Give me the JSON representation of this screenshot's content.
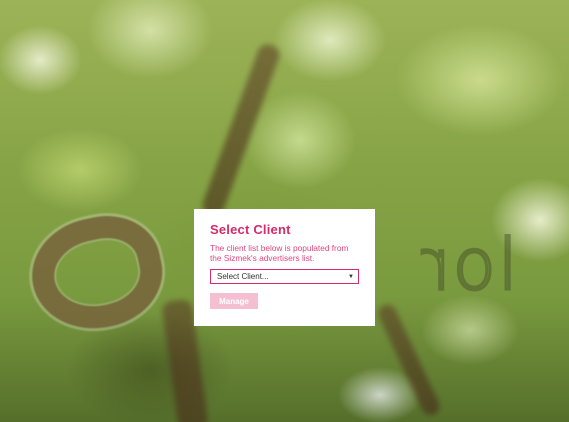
{
  "background": {
    "logo_text": "lor",
    "colors": {
      "foliage": "#86a445",
      "highlight": "#f0f8d7"
    }
  },
  "panel": {
    "title": "Select Client",
    "description": "The client list below is populated from the Sizmek's advertisers list.",
    "select": {
      "selected": "Select Client...",
      "caret_icon": "caret-down-icon"
    },
    "manage_label": "Manage",
    "colors": {
      "accent": "#d62b6a",
      "text": "#e0477f",
      "button_disabled": "#f5bfd2"
    }
  }
}
